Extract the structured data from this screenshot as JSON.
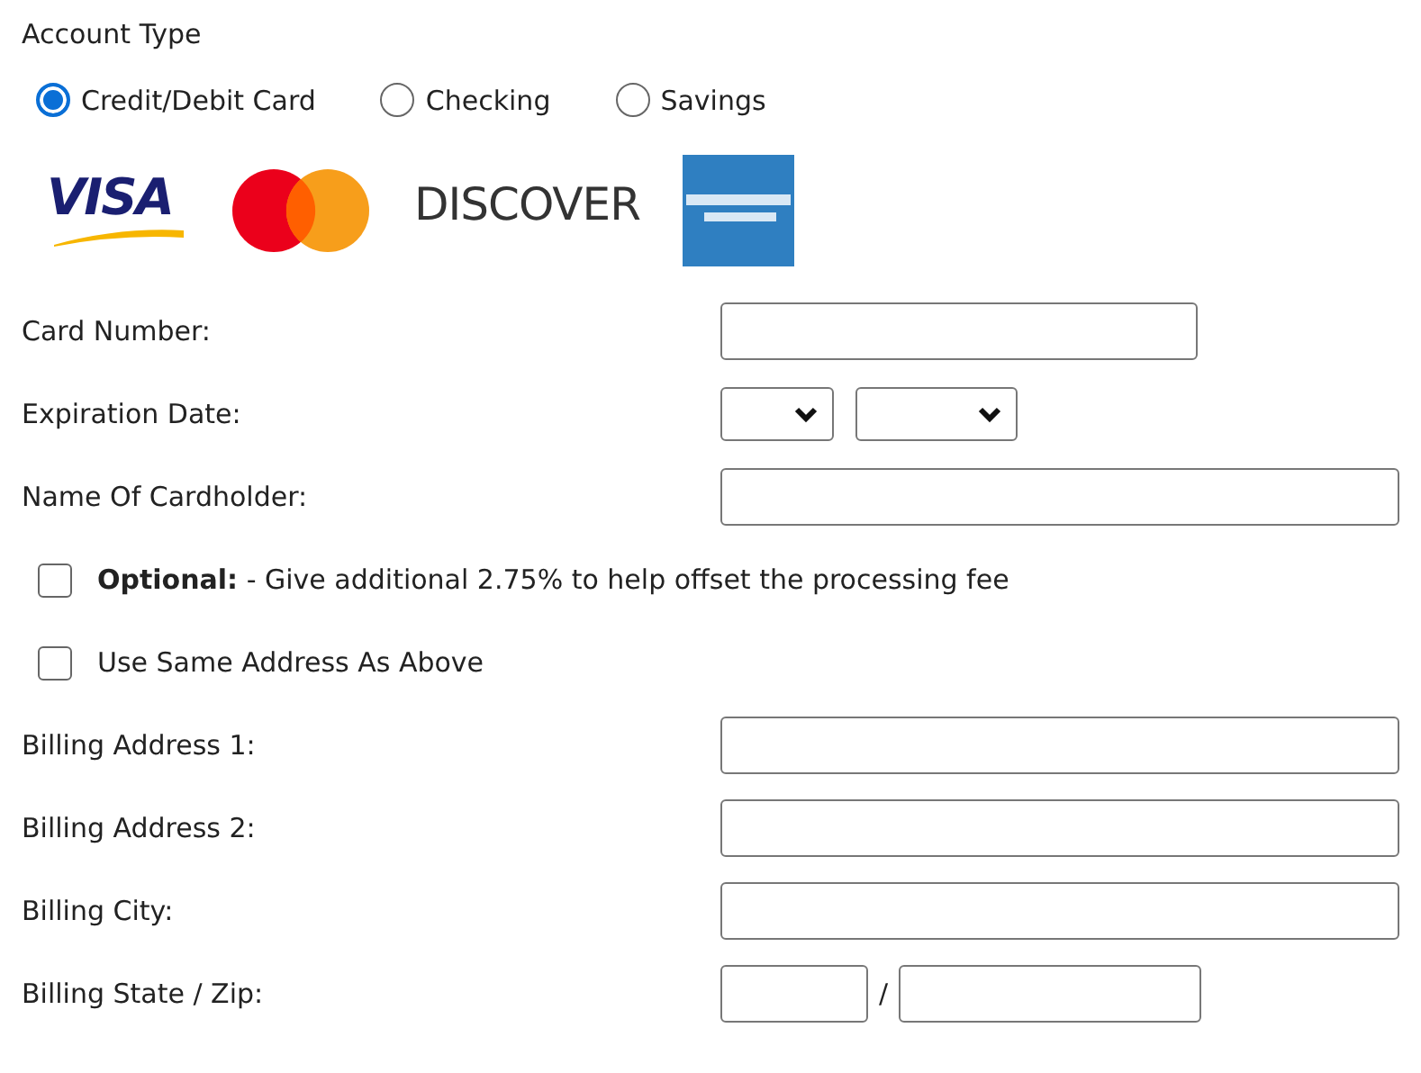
{
  "account_type": {
    "label": "Account Type",
    "options": [
      {
        "label": "Credit/Debit Card",
        "selected": true
      },
      {
        "label": "Checking",
        "selected": false
      },
      {
        "label": "Savings",
        "selected": false
      }
    ]
  },
  "card_logos": [
    {
      "kind": "visa",
      "text": "VISA"
    },
    {
      "kind": "mastercard"
    },
    {
      "kind": "discover",
      "text": "DISCOVER"
    },
    {
      "kind": "amex"
    }
  ],
  "rows": [
    {
      "kind": "short-text",
      "label": "Card Number:"
    },
    {
      "kind": "selects",
      "label": "Expiration Date:"
    },
    {
      "kind": "text",
      "label": "Name Of Cardholder:"
    },
    {
      "kind": "checkbox",
      "text": "**Optional:** - Give additional 2.75% to help offset the processing fee",
      "checked": false
    },
    {
      "kind": "checkbox",
      "text": "Use Same Address As Above",
      "checked": false
    },
    {
      "kind": "text",
      "label": "Billing Address 1:"
    },
    {
      "kind": "text",
      "label": "Billing Address 2:"
    },
    {
      "kind": "text",
      "label": "Billing City:"
    },
    {
      "kind": "state-zip",
      "label": "Billing State / Zip:",
      "separator": "/"
    }
  ]
}
